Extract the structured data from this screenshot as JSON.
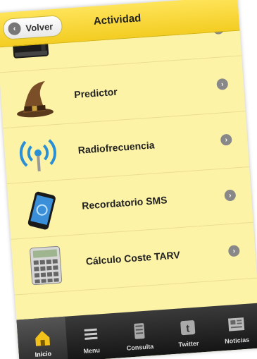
{
  "header": {
    "back_label": "Volver",
    "title": "Actividad"
  },
  "list": {
    "items": [
      {
        "label": "",
        "icon": "notebook-icon"
      },
      {
        "label": "Predictor",
        "icon": "wizard-hat-icon"
      },
      {
        "label": "Radiofrecuencia",
        "icon": "radio-signal-icon"
      },
      {
        "label": "Recordatorio SMS",
        "icon": "mobile-phone-icon"
      },
      {
        "label": "Cálculo Coste TARV",
        "icon": "calculator-icon"
      }
    ]
  },
  "tabbar": {
    "items": [
      {
        "label": "Inicio",
        "icon": "home-icon",
        "active": true
      },
      {
        "label": "Menu",
        "icon": "menu-list-icon"
      },
      {
        "label": "Consulta",
        "icon": "server-icon"
      },
      {
        "label": "Twitter",
        "icon": "twitter-icon"
      },
      {
        "label": "Noticias",
        "icon": "newspaper-icon"
      }
    ]
  },
  "colors": {
    "header": "#f3cd22",
    "list_background": "#fdf3a6",
    "tabbar": "#1f1f1f"
  }
}
